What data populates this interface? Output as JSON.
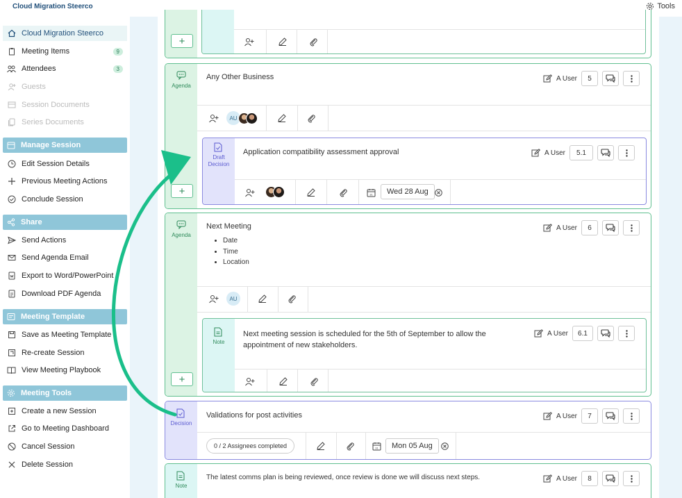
{
  "app": {
    "title": "Cloud Migration Steerco",
    "tools_label": "Tools"
  },
  "sidebar": {
    "home": {
      "label": "Cloud Migration Steerco"
    },
    "items": [
      {
        "label": "Meeting Items",
        "count": "9"
      },
      {
        "label": "Attendees",
        "count": "3"
      },
      {
        "label": "Guests"
      },
      {
        "label": "Session Documents"
      },
      {
        "label": "Series Documents"
      }
    ],
    "sections": [
      {
        "title": "Manage Session",
        "items": [
          "Edit Session Details",
          "Previous Meeting Actions",
          "Conclude Session"
        ]
      },
      {
        "title": "Share",
        "items": [
          "Send Actions",
          "Send Agenda Email",
          "Export to Word/PowerPoint",
          "Download PDF Agenda"
        ]
      },
      {
        "title": "Meeting Template",
        "items": [
          "Save as Meeting Template",
          "Re-create Session",
          "View Meeting Playbook"
        ]
      },
      {
        "title": "Meeting Tools",
        "items": [
          "Create a new Session",
          "Go to Meeting Dashboard",
          "Cancel Session",
          "Delete Session"
        ]
      }
    ]
  },
  "items": {
    "aob": {
      "type_label": "Agenda",
      "title": "Any Other Business",
      "user": "A User",
      "number": "5",
      "assignee_initials": "AU"
    },
    "aob_decision": {
      "type_label": "Draft Decision",
      "title": "Application compatibility assessment approval",
      "user": "A User",
      "number": "5.1",
      "due_date": "Wed 28 Aug"
    },
    "next_meeting": {
      "type_label": "Agenda",
      "title": "Next Meeting",
      "bullets": [
        "Date",
        "Time",
        "Location"
      ],
      "user": "A User",
      "number": "6",
      "assignee_initials": "AU"
    },
    "next_note": {
      "type_label": "Note",
      "title": "Next meeting session is scheduled for the 5th of September to allow the appointment of new stakeholders.",
      "user": "A User",
      "number": "6.1"
    },
    "validations": {
      "type_label": "Decision",
      "title": "Validations for post activities",
      "user": "A User",
      "number": "7",
      "assignees_status": "0 / 2 Assignees completed",
      "due_date": "Mon 05 Aug"
    },
    "comms": {
      "type_label": "Note",
      "title": "The latest comms plan is being reviewed, once review is done we will discuss next steps.",
      "user": "A User",
      "number": "8"
    }
  },
  "colors": {
    "arrow": "#1bbf8a",
    "agenda_rail": "#dcf3e4",
    "decision_rail": "#e2e3fb",
    "section_header": "#8fc6d9"
  }
}
